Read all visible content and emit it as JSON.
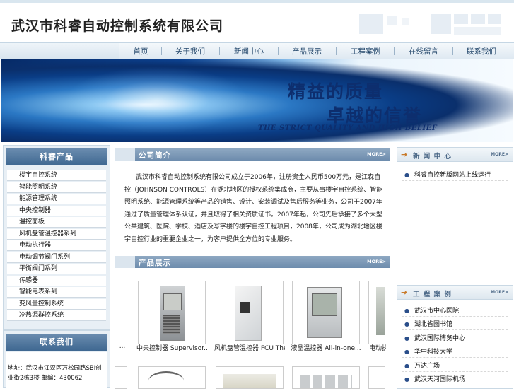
{
  "header": {
    "company_name": "武汉市科睿自动控制系统有限公司"
  },
  "nav": [
    {
      "label": "首页"
    },
    {
      "label": "关于我们"
    },
    {
      "label": "新闻中心"
    },
    {
      "label": "产品展示"
    },
    {
      "label": "工程案例"
    },
    {
      "label": "在线留言"
    },
    {
      "label": "联系我们"
    }
  ],
  "banner": {
    "line1": "精益的质量",
    "line2": "卓越的信誉",
    "line3": "THE  STRICT QUALITY AND HIGH BELIEF"
  },
  "sidebar": {
    "products_title": "科睿产品",
    "products": [
      {
        "label": "楼宇自控系统"
      },
      {
        "label": "智能照明系统"
      },
      {
        "label": "能源管理系统"
      },
      {
        "label": "中央控制器"
      },
      {
        "label": "温控面板"
      },
      {
        "label": "风机盘管温控器系列"
      },
      {
        "label": "电动执行器"
      },
      {
        "label": "电动调节阀门系列"
      },
      {
        "label": "平衡阀门系列"
      },
      {
        "label": "传感器"
      },
      {
        "label": "智能电表系列"
      },
      {
        "label": "变风量控制系统"
      },
      {
        "label": "冷热源群控系统"
      }
    ],
    "contact_title": "联系我们",
    "contact_text": "地址：武汉市江汉区万松园路SBI创业街2栋3楼 邮编：430062"
  },
  "intro": {
    "title": "公司简介",
    "more": "MORE>",
    "text": "武汉市科睿自动控制系统有限公司成立于2006年，注册资金人民币500万元，是江森自控（JOHNSON CONTROLS）在湖北地区的授权系统集成商，主要从事楼宇自控系统、智能照明系统、能源管理系统等产品的销售、设计、安装调试及售后服务等业务，公司于2007年通过了质量管理体系认证，并且取得了相关资质证书。2007年起，公司先后承接了多个大型公共建筑、医院、学校、酒店及写字楼的楼宇自控工程项目，2008年，公司成为湖北地区楼宇自控行业的重要企业之一，为客户提供全方位的专业服务。"
  },
  "products_section": {
    "title": "产品展示",
    "more": "MORE>",
    "items": [
      {
        "caption": "中央控制器 Supervisor..."
      },
      {
        "caption": "风机盘管温控器 FCU The..."
      },
      {
        "caption": "液晶温控器 All-in-one..."
      },
      {
        "caption": "电动执行"
      }
    ],
    "partial_left_caption": "..."
  },
  "news": {
    "title": "新 闻 中 心",
    "more": "MORE>",
    "items": [
      {
        "label": "科睿自控新版网站上线运行"
      }
    ]
  },
  "projects": {
    "title": "工 程 案 例",
    "more": "MORE>",
    "items": [
      {
        "label": "武汉市中心医院"
      },
      {
        "label": "湖北省图书馆"
      },
      {
        "label": "武汉国际博览中心"
      },
      {
        "label": "华中科技大学"
      },
      {
        "label": "万达广场"
      },
      {
        "label": "武汉天河国际机场"
      }
    ]
  }
}
